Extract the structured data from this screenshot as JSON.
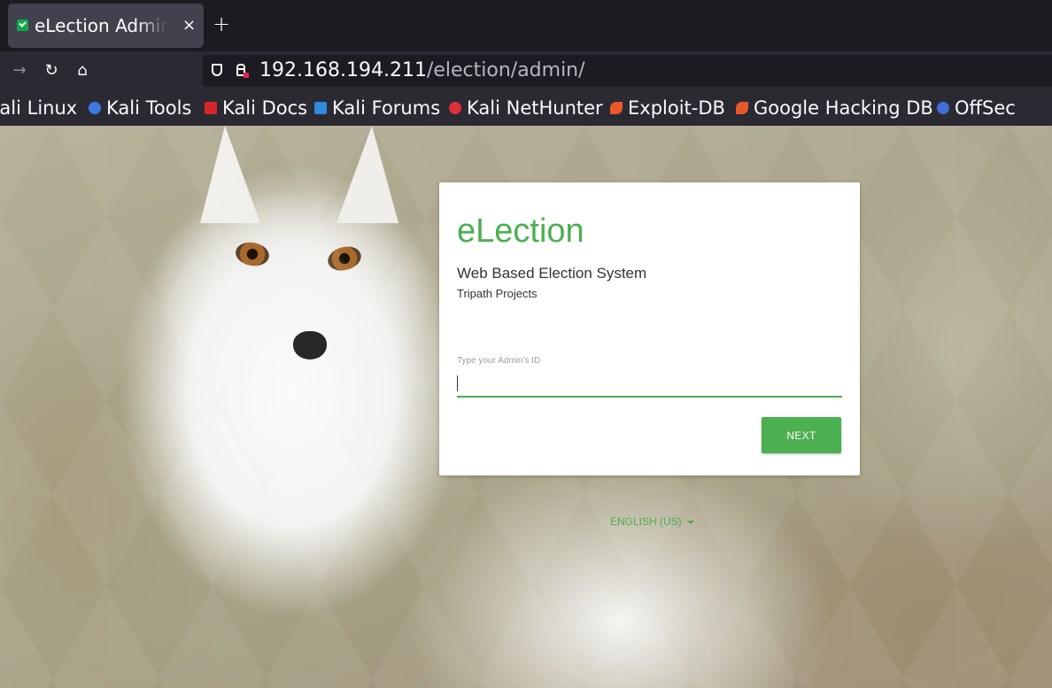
{
  "browser": {
    "tab": {
      "title": "eLection Administration",
      "close": "×"
    },
    "new_tab": "+",
    "nav": {
      "back": "→",
      "reload": "↻",
      "home": "⌂"
    },
    "url": {
      "host": "192.168.194.211",
      "path": "/election/admin/"
    },
    "bookmarks": [
      {
        "label": "Kali Linux",
        "icon": "kali-dragon-icon",
        "color": "#2b2a33"
      },
      {
        "label": "Kali Tools",
        "icon": "kali-tools-icon",
        "color": "#3b7ae0"
      },
      {
        "label": "Kali Docs",
        "icon": "kali-docs-icon",
        "color": "#d7262b"
      },
      {
        "label": "Kali Forums",
        "icon": "kali-forums-icon",
        "color": "#2f8ae0"
      },
      {
        "label": "Kali NetHunter",
        "icon": "kali-nethunter-icon",
        "color": "#e0303a"
      },
      {
        "label": "Exploit-DB",
        "icon": "exploit-db-icon",
        "color": "#e8582b"
      },
      {
        "label": "Google Hacking DB",
        "icon": "ghdb-icon",
        "color": "#e8582b"
      },
      {
        "label": "OffSec",
        "icon": "offsec-icon",
        "color": "#3f6fd8"
      }
    ]
  },
  "login": {
    "brand": "eLection",
    "subtitle": "Web Based Election System",
    "org": "Tripath Projects",
    "field_label": "Type your Admin's ID",
    "field_value": "",
    "next_label": "NEXT",
    "accent": "#4caf50"
  },
  "language": {
    "label": "ENGLISH (US)"
  }
}
